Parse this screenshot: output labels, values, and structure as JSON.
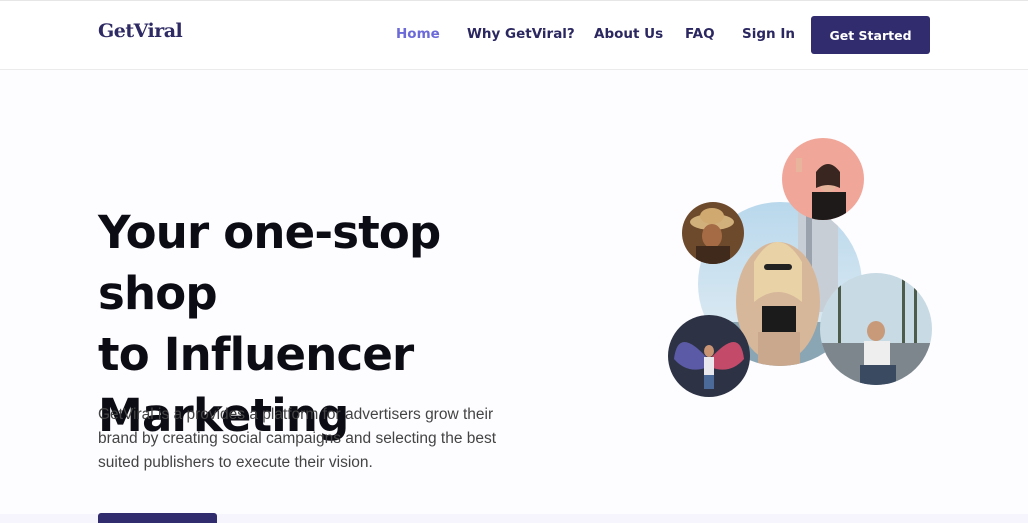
{
  "brand": {
    "logo": "GetViral"
  },
  "nav": {
    "items": [
      {
        "label": "Home",
        "active": true
      },
      {
        "label": "Why GetViral?"
      },
      {
        "label": "About Us"
      },
      {
        "label": "FAQ"
      },
      {
        "label": "Sign In"
      }
    ],
    "cta": "Get Started"
  },
  "hero": {
    "headline_lines": [
      "Your one-stop shop",
      "to Influencer",
      "Marketing"
    ],
    "description": "GetViral is a provides a platform for advertisers grow their brand by creating social campaigns and selecting the best suited publishers to execute their vision."
  },
  "colors": {
    "brand": "#312c6e",
    "nav_text": "#2b2760",
    "nav_active": "#6b6ad8",
    "headline": "#0c0c14"
  },
  "images": [
    "influencer-selfie-photo",
    "influencer-hat-photo",
    "influencer-main-photo",
    "influencer-city-photo",
    "influencer-wings-photo"
  ]
}
